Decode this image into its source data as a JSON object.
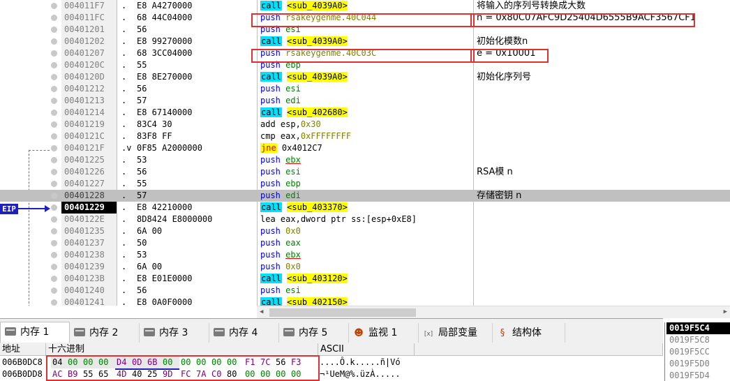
{
  "disasm": {
    "rows": [
      {
        "addr": "004011F7",
        "mark": ".",
        "bytes": "E8 A4270000",
        "mn": "call",
        "ops": [
          {
            "t": "<sub_4039A0>",
            "c": "sub"
          }
        ],
        "comment": "将输入的序列号转换成大数"
      },
      {
        "addr": "004011FC",
        "mark": ".",
        "bytes": "68 44C04000",
        "mn": "push",
        "ops": [
          {
            "t": "rsakeygenme.40C044",
            "c": "lbl"
          }
        ],
        "comment": "n = 0x80C07AFC9D25404D6555B9ACF3567CF1"
      },
      {
        "addr": "00401201",
        "mark": ".",
        "bytes": "56",
        "mn": "push",
        "ops": [
          {
            "t": "esi",
            "c": "reg"
          }
        ],
        "comment": ""
      },
      {
        "addr": "00401202",
        "mark": ".",
        "bytes": "E8 99270000",
        "mn": "call",
        "ops": [
          {
            "t": "<sub_4039A0>",
            "c": "sub"
          }
        ],
        "comment": "初始化模数n"
      },
      {
        "addr": "00401207",
        "mark": ".",
        "bytes": "68 3CC04000",
        "mn": "push",
        "ops": [
          {
            "t": "rsakeygenme.40C03C",
            "c": "lbl"
          }
        ],
        "comment": "e = 0x10001"
      },
      {
        "addr": "0040120C",
        "mark": ".",
        "bytes": "55",
        "mn": "push",
        "ops": [
          {
            "t": "ebp",
            "c": "reg"
          }
        ],
        "comment": ""
      },
      {
        "addr": "0040120D",
        "mark": ".",
        "bytes": "E8 8E270000",
        "mn": "call",
        "ops": [
          {
            "t": "<sub_4039A0>",
            "c": "sub"
          }
        ],
        "comment": "初始化序列号"
      },
      {
        "addr": "00401212",
        "mark": ".",
        "bytes": "56",
        "mn": "push",
        "ops": [
          {
            "t": "esi",
            "c": "reg"
          }
        ],
        "comment": ""
      },
      {
        "addr": "00401213",
        "mark": ".",
        "bytes": "57",
        "mn": "push",
        "ops": [
          {
            "t": "edi",
            "c": "reg"
          }
        ],
        "comment": ""
      },
      {
        "addr": "00401214",
        "mark": ".",
        "bytes": "E8 67140000",
        "mn": "call",
        "ops": [
          {
            "t": "<sub_402680>",
            "c": "sub"
          }
        ],
        "comment": ""
      },
      {
        "addr": "00401219",
        "mark": ".",
        "bytes": "83C4 30",
        "mn": "add",
        "ops": [
          {
            "t": "esp,",
            "c": "mem"
          },
          {
            "t": "0x30",
            "c": "hex"
          }
        ],
        "comment": ""
      },
      {
        "addr": "0040121C",
        "mark": ".",
        "bytes": "83F8 FF",
        "mn": "cmp",
        "ops": [
          {
            "t": "eax,",
            "c": "mem"
          },
          {
            "t": "0xFFFFFFFF",
            "c": "hex"
          }
        ],
        "comment": ""
      },
      {
        "addr": "0040121F",
        "mark": ".v",
        "bytes": "0F85 A2000000",
        "mn": "jne",
        "ops": [
          {
            "t": "0x4012C7",
            "c": "mem"
          }
        ],
        "comment": ""
      },
      {
        "addr": "00401225",
        "mark": ".",
        "bytes": "53",
        "mn": "push",
        "ops": [
          {
            "t": "ebx",
            "c": "ebx"
          }
        ],
        "comment": ""
      },
      {
        "addr": "00401226",
        "mark": ".",
        "bytes": "56",
        "mn": "push",
        "ops": [
          {
            "t": "esi",
            "c": "reg"
          }
        ],
        "comment": "RSA模 n"
      },
      {
        "addr": "00401227",
        "mark": ".",
        "bytes": "55",
        "mn": "push",
        "ops": [
          {
            "t": "ebp",
            "c": "reg"
          }
        ],
        "comment": ""
      },
      {
        "addr": "00401228",
        "mark": ".",
        "bytes": "57",
        "mn": "push",
        "ops": [
          {
            "t": "edi",
            "c": "reg"
          }
        ],
        "comment": "存储密钥 n"
      },
      {
        "addr": "00401229",
        "mark": ".",
        "bytes": "E8 42210000",
        "mn": "call",
        "ops": [
          {
            "t": "<sub_403370>",
            "c": "sub"
          }
        ],
        "comment": ""
      },
      {
        "addr": "0040122E",
        "mark": ".",
        "bytes": "8D8424 E8000000",
        "mn": "lea",
        "ops": [
          {
            "t": "eax,dword ptr ss:[esp+0xE8]",
            "c": "mem"
          }
        ],
        "comment": ""
      },
      {
        "addr": "00401235",
        "mark": ".",
        "bytes": "6A 00",
        "mn": "push",
        "ops": [
          {
            "t": "0x0",
            "c": "hex"
          }
        ],
        "comment": ""
      },
      {
        "addr": "00401237",
        "mark": ".",
        "bytes": "50",
        "mn": "push",
        "ops": [
          {
            "t": "eax",
            "c": "reg"
          }
        ],
        "comment": ""
      },
      {
        "addr": "00401238",
        "mark": ".",
        "bytes": "53",
        "mn": "push",
        "ops": [
          {
            "t": "ebx",
            "c": "ebx"
          }
        ],
        "comment": ""
      },
      {
        "addr": "00401239",
        "mark": ".",
        "bytes": "6A 00",
        "mn": "push",
        "ops": [
          {
            "t": "0x0",
            "c": "hex"
          }
        ],
        "comment": ""
      },
      {
        "addr": "0040123B",
        "mark": ".",
        "bytes": "E8 E01E0000",
        "mn": "call",
        "ops": [
          {
            "t": "<sub_403120>",
            "c": "sub"
          }
        ],
        "comment": ""
      },
      {
        "addr": "00401240",
        "mark": ".",
        "bytes": "56",
        "mn": "push",
        "ops": [
          {
            "t": "esi",
            "c": "reg"
          }
        ],
        "comment": ""
      },
      {
        "addr": "00401241",
        "mark": ".",
        "bytes": "E8 0A0F0000",
        "mn": "call",
        "ops": [
          {
            "t": "<sub_402150>",
            "c": "sub"
          }
        ],
        "comment": ""
      }
    ],
    "selected_addr": "00401228",
    "eip_addr": "00401229",
    "eip_label": "EIP"
  },
  "tabs": [
    {
      "label": "内存 1",
      "icon": "memory-icon",
      "active": true
    },
    {
      "label": "内存 2",
      "icon": "memory-icon",
      "active": false
    },
    {
      "label": "内存 3",
      "icon": "memory-icon",
      "active": false
    },
    {
      "label": "内存 4",
      "icon": "memory-icon",
      "active": false
    },
    {
      "label": "内存 5",
      "icon": "memory-icon",
      "active": false
    },
    {
      "label": "监视 1",
      "icon": "watch-icon",
      "active": false
    },
    {
      "label": "局部变量",
      "icon": "locals-icon",
      "active": false
    },
    {
      "label": "结构体",
      "icon": "struct-icon",
      "active": false
    }
  ],
  "dump": {
    "headers": {
      "addr": "地址",
      "hex": "十六进制",
      "ascii": "ASCII"
    },
    "rows": [
      {
        "addr": "006B0DC8",
        "groups": [
          [
            "04",
            "00",
            "00",
            "00"
          ],
          [
            "D4",
            "0D",
            "6B",
            "00"
          ],
          [
            "00",
            "00",
            "00",
            "00"
          ],
          [
            "F1",
            "7C",
            "56",
            "F3"
          ]
        ],
        "ascii": "....Ô.k.....ñ|Vó"
      },
      {
        "addr": "006B0DD8",
        "groups": [
          [
            "AC",
            "B9",
            "55",
            "65"
          ],
          [
            "4D",
            "40",
            "25",
            "9D"
          ],
          [
            "FC",
            "7A",
            "C0",
            "80"
          ],
          [
            "00",
            "00",
            "00",
            "00"
          ]
        ],
        "ascii": "¬¹UeM@%.üzÀ....."
      }
    ]
  },
  "stack": {
    "rows": [
      "0019F5C4",
      "0019F5C8",
      "0019F5CC",
      "0019F5D0",
      "0019F5D4"
    ]
  },
  "colors": {
    "accent_red": "#e03030",
    "call_bg": "#00e0ff",
    "sub_bg": "#ffff00",
    "eip_bg": "#2020c0"
  }
}
